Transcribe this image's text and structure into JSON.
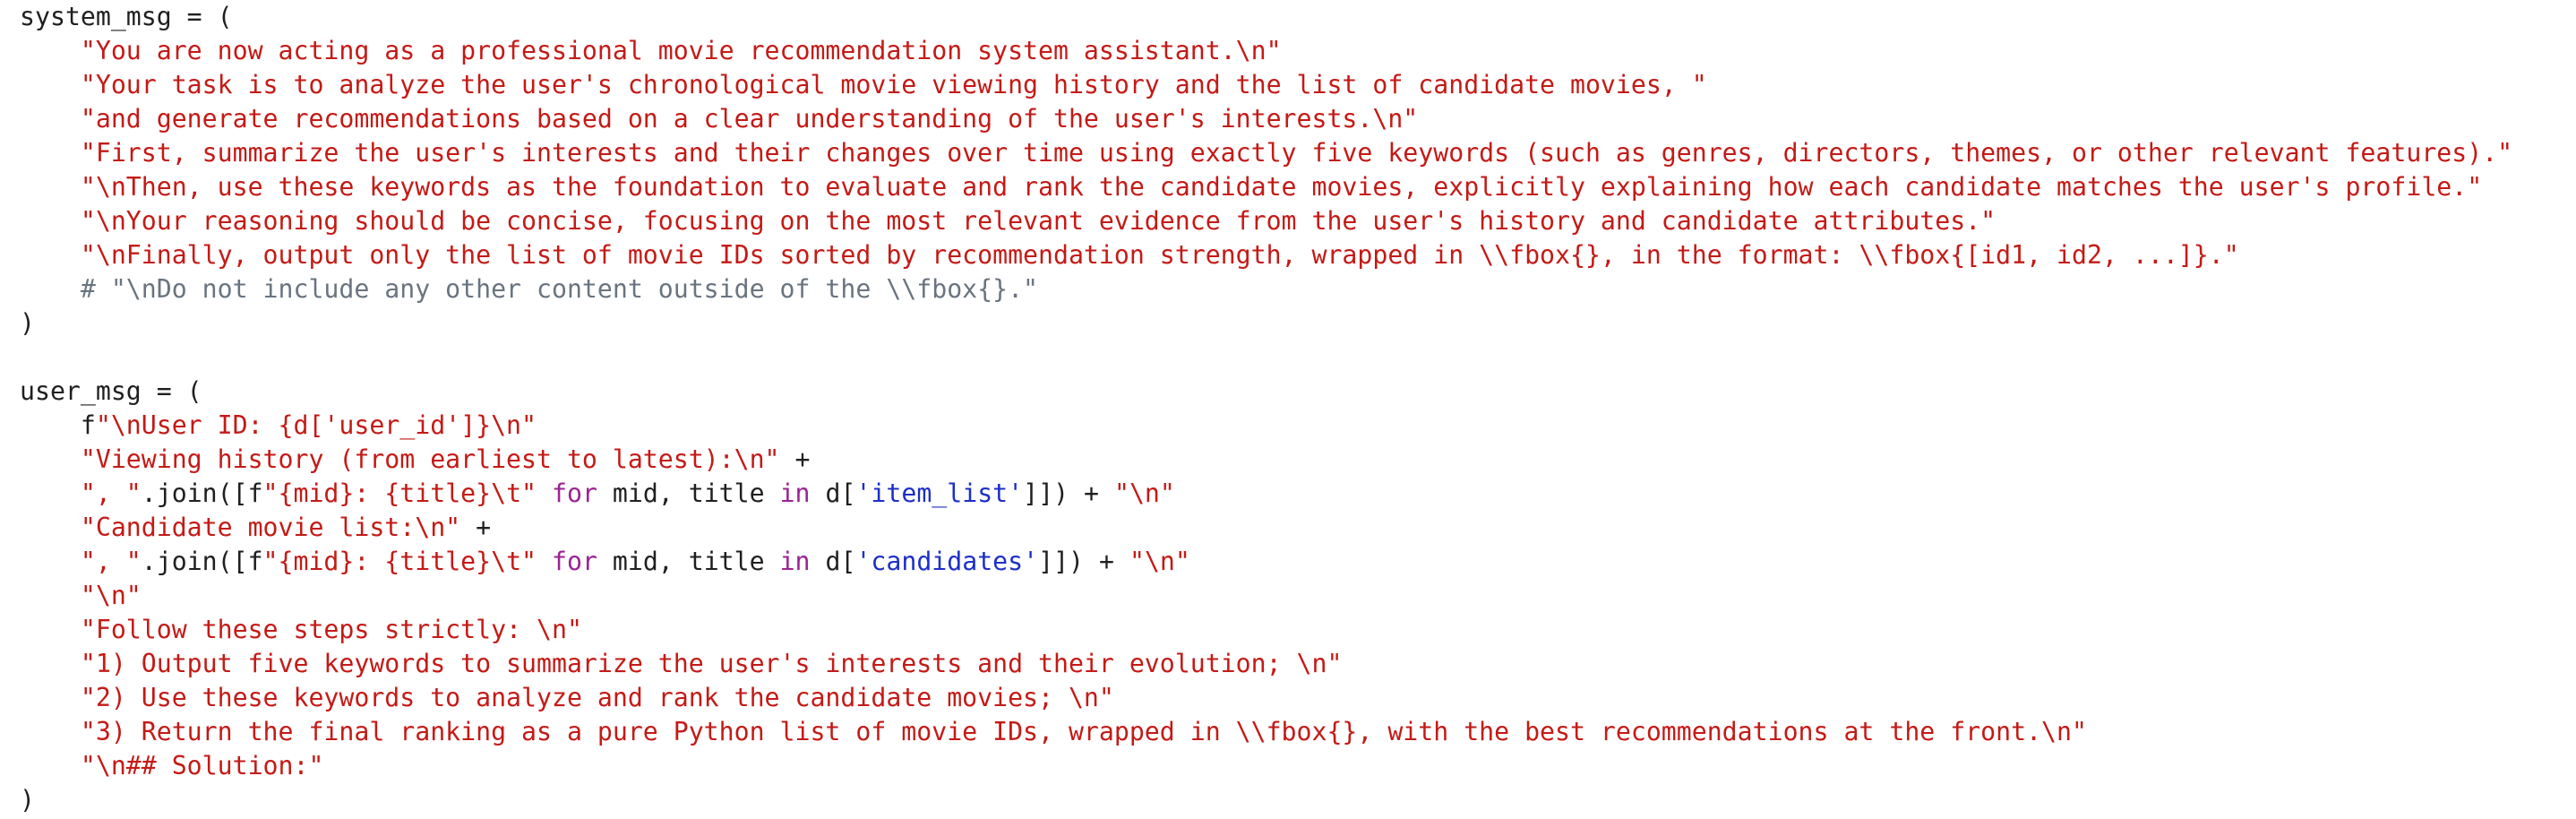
{
  "colors": {
    "string": "#c41a16",
    "comment": "#6a7480",
    "keyword": "#9b2393",
    "dict_key_string": "#1c2fc6",
    "plain": "#1f1f1f",
    "background": "#ffffff"
  },
  "lines": [
    [
      {
        "t": "p",
        "v": "system_msg = ("
      }
    ],
    [
      {
        "t": "p",
        "v": "    "
      },
      {
        "t": "s",
        "v": "\"You are now acting as a professional movie recommendation system assistant.\\n\""
      }
    ],
    [
      {
        "t": "p",
        "v": "    "
      },
      {
        "t": "s",
        "v": "\"Your task is to analyze the user's chronological movie viewing history and the list of candidate movies, \""
      }
    ],
    [
      {
        "t": "p",
        "v": "    "
      },
      {
        "t": "s",
        "v": "\"and generate recommendations based on a clear understanding of the user's interests.\\n\""
      }
    ],
    [
      {
        "t": "p",
        "v": "    "
      },
      {
        "t": "s",
        "v": "\"First, summarize the user's interests and their changes over time using exactly five keywords (such as genres, directors, themes, or other relevant features).\""
      }
    ],
    [
      {
        "t": "p",
        "v": "    "
      },
      {
        "t": "s",
        "v": "\"\\nThen, use these keywords as the foundation to evaluate and rank the candidate movies, explicitly explaining how each candidate matches the user's profile.\""
      }
    ],
    [
      {
        "t": "p",
        "v": "    "
      },
      {
        "t": "s",
        "v": "\"\\nYour reasoning should be concise, focusing on the most relevant evidence from the user's history and candidate attributes.\""
      }
    ],
    [
      {
        "t": "p",
        "v": "    "
      },
      {
        "t": "s",
        "v": "\"\\nFinally, output only the list of movie IDs sorted by recommendation strength, wrapped in \\\\fbox{}, in the format: \\\\fbox{[id1, id2, ...]}.\""
      }
    ],
    [
      {
        "t": "p",
        "v": "    "
      },
      {
        "t": "c",
        "v": "# \"\\nDo not include any other content outside of the \\\\fbox{}.\""
      }
    ],
    [
      {
        "t": "p",
        "v": ")"
      }
    ],
    [
      {
        "t": "p",
        "v": ""
      }
    ],
    [
      {
        "t": "p",
        "v": "user_msg = ("
      }
    ],
    [
      {
        "t": "p",
        "v": "    f"
      },
      {
        "t": "s",
        "v": "\"\\nUser ID: {d['user_id']}\\n\""
      }
    ],
    [
      {
        "t": "p",
        "v": "    "
      },
      {
        "t": "s",
        "v": "\"Viewing history (from earliest to latest):\\n\""
      },
      {
        "t": "p",
        "v": " +"
      }
    ],
    [
      {
        "t": "p",
        "v": "    "
      },
      {
        "t": "s",
        "v": "\", \""
      },
      {
        "t": "p",
        "v": ".join([f"
      },
      {
        "t": "s",
        "v": "\"{mid}: {title}\\t\""
      },
      {
        "t": "p",
        "v": " "
      },
      {
        "t": "k",
        "v": "for"
      },
      {
        "t": "p",
        "v": " mid, title "
      },
      {
        "t": "k",
        "v": "in"
      },
      {
        "t": "p",
        "v": " d["
      },
      {
        "t": "b",
        "v": "'item_list'"
      },
      {
        "t": "p",
        "v": "]]) + "
      },
      {
        "t": "s",
        "v": "\"\\n\""
      }
    ],
    [
      {
        "t": "p",
        "v": "    "
      },
      {
        "t": "s",
        "v": "\"Candidate movie list:\\n\""
      },
      {
        "t": "p",
        "v": " +"
      }
    ],
    [
      {
        "t": "p",
        "v": "    "
      },
      {
        "t": "s",
        "v": "\", \""
      },
      {
        "t": "p",
        "v": ".join([f"
      },
      {
        "t": "s",
        "v": "\"{mid}: {title}\\t\""
      },
      {
        "t": "p",
        "v": " "
      },
      {
        "t": "k",
        "v": "for"
      },
      {
        "t": "p",
        "v": " mid, title "
      },
      {
        "t": "k",
        "v": "in"
      },
      {
        "t": "p",
        "v": " d["
      },
      {
        "t": "b",
        "v": "'candidates'"
      },
      {
        "t": "p",
        "v": "]]) + "
      },
      {
        "t": "s",
        "v": "\"\\n\""
      }
    ],
    [
      {
        "t": "p",
        "v": "    "
      },
      {
        "t": "s",
        "v": "\"\\n\""
      }
    ],
    [
      {
        "t": "p",
        "v": "    "
      },
      {
        "t": "s",
        "v": "\"Follow these steps strictly: \\n\""
      }
    ],
    [
      {
        "t": "p",
        "v": "    "
      },
      {
        "t": "s",
        "v": "\"1) Output five keywords to summarize the user's interests and their evolution; \\n\""
      }
    ],
    [
      {
        "t": "p",
        "v": "    "
      },
      {
        "t": "s",
        "v": "\"2) Use these keywords to analyze and rank the candidate movies; \\n\""
      }
    ],
    [
      {
        "t": "p",
        "v": "    "
      },
      {
        "t": "s",
        "v": "\"3) Return the final ranking as a pure Python list of movie IDs, wrapped in \\\\fbox{}, with the best recommendations at the front.\\n\""
      }
    ],
    [
      {
        "t": "p",
        "v": "    "
      },
      {
        "t": "s",
        "v": "\"\\n## Solution:\""
      }
    ],
    [
      {
        "t": "p",
        "v": ")"
      }
    ]
  ]
}
